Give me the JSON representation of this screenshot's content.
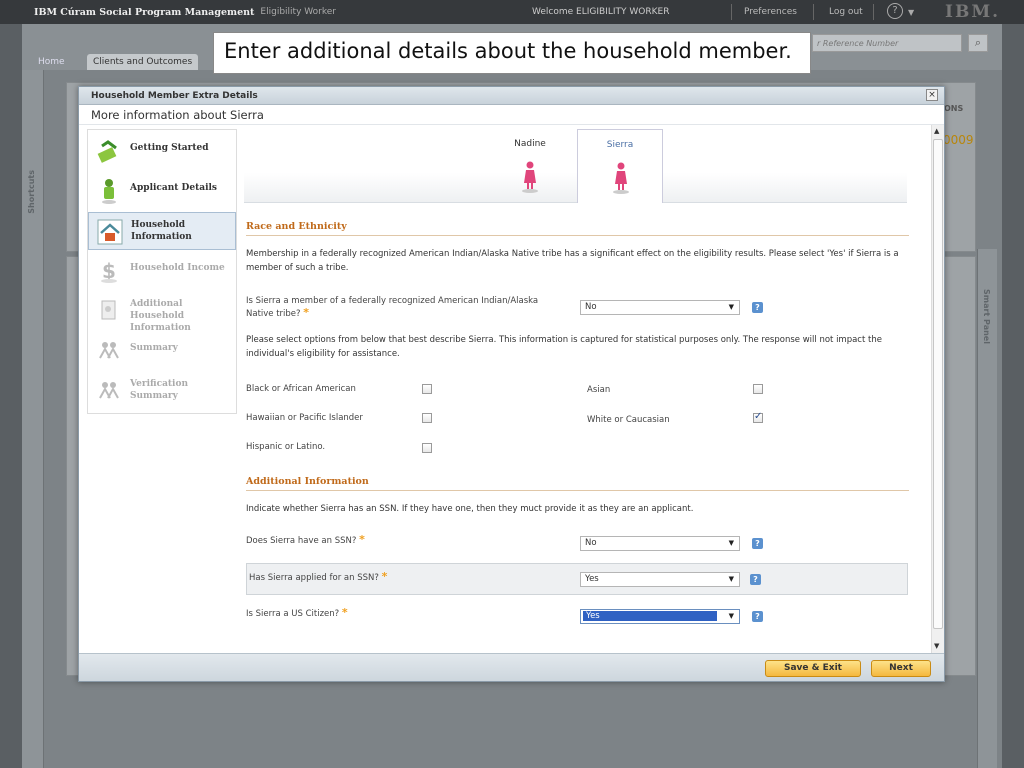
{
  "topbar": {
    "brand": "IBM Cúram Social Program Management",
    "role": "Eligibility Worker",
    "welcome": "Welcome ELIGIBILITY WORKER",
    "preferences": "Preferences",
    "logout": "Log out",
    "help_glyph": "?",
    "logo": "IBM."
  },
  "shell": {
    "tabs": [
      "Home",
      "Clients and Outcomes"
    ],
    "search_placeholder": "r Reference Number",
    "shortcuts_label": "Shortcuts",
    "smart_panel_label": "Smart Panel",
    "frag_case": "0009",
    "frag_options": "ONS"
  },
  "callout": "Enter additional details about the household member.",
  "modal": {
    "title": "Household Member Extra Details",
    "subtitle": "More information about Sierra",
    "close_glyph": "×",
    "wizard": [
      {
        "label": "Getting Started",
        "state": "done"
      },
      {
        "label": "Applicant Details",
        "state": "done"
      },
      {
        "label": "Household Information",
        "state": "active"
      },
      {
        "label": "Household Income",
        "state": "disabled"
      },
      {
        "label": "Additional Household Information",
        "state": "disabled"
      },
      {
        "label": "Summary",
        "state": "disabled"
      },
      {
        "label": "Verification Summary",
        "state": "disabled"
      }
    ],
    "members": [
      {
        "name": "Nadine",
        "active": false
      },
      {
        "name": "Sierra",
        "active": true
      }
    ],
    "race": {
      "heading": "Race and Ethnicity",
      "intro": "Membership in a federally recognized American Indian/Alaska Native tribe has a significant effect on the eligibility results. Please select 'Yes' if Sierra is a member of such a tribe.",
      "tribe_question": "Is Sierra a member of a federally recognized American Indian/Alaska Native tribe?",
      "tribe_value": "No",
      "stat_text": "Please select options from below that best describe Sierra. This information is captured for statistical purposes only. The response will not impact the individual's eligibility for assistance.",
      "options": [
        {
          "label": "Black or African American",
          "checked": false
        },
        {
          "label": "Asian",
          "checked": false
        },
        {
          "label": "Hawaiian or Pacific Islander",
          "checked": false
        },
        {
          "label": "White or Caucasian",
          "checked": true
        },
        {
          "label": "Hispanic or Latino.",
          "checked": false
        }
      ]
    },
    "additional": {
      "heading": "Additional Information",
      "intro": "Indicate whether Sierra has an SSN. If they have one, then they muct provide it as they are an applicant.",
      "q1": "Does Sierra have an SSN?",
      "a1": "No",
      "q2": "Has Sierra applied for an SSN?",
      "a2": "Yes",
      "q3": "Is Sierra a US Citizen?",
      "a3": "Yes"
    },
    "req_mark": "*",
    "help_mark": "?",
    "buttons": {
      "save_exit": "Save & Exit",
      "next": "Next"
    }
  },
  "colors": {
    "accent": "#c06a1a",
    "button": "#f5b83e",
    "selection": "#2f61c3"
  }
}
